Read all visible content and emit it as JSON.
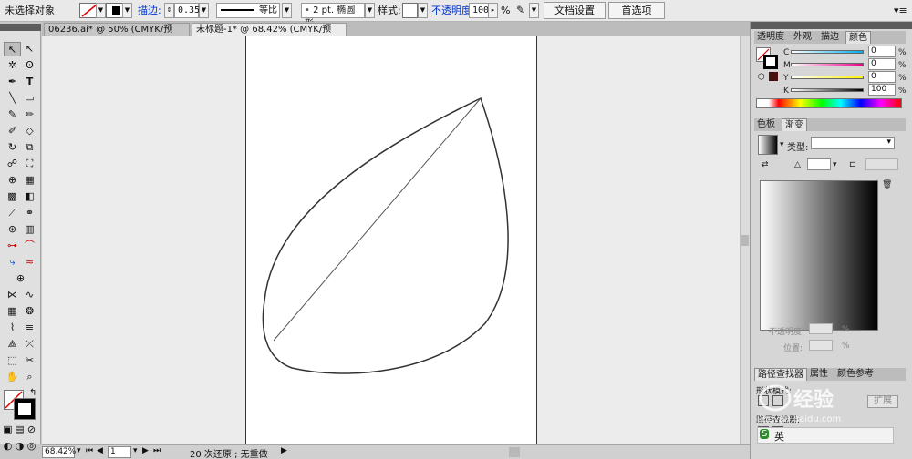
{
  "control_bar": {
    "selection_label": "未选择对象",
    "stroke_label": "描边:",
    "stroke_value": "0.353:",
    "profile_label": "等比",
    "brush_label": "2 pt. 椭圆形",
    "style_label": "样式:",
    "opacity_label": "不透明度:",
    "opacity_value": "100",
    "percent": "%",
    "doc_setup_button": "文档设置",
    "prefs_button": "首选项"
  },
  "tabs": [
    {
      "label": "06236.ai* @ 50% (CMYK/预览)",
      "active": false
    },
    {
      "label": "未标题-1* @ 68.42% (CMYK/预览)",
      "active": true
    }
  ],
  "tab_close": "✕",
  "status_bar": {
    "zoom": "68.42%",
    "page": "1",
    "undo_text": "20 次还原 ; 无重做"
  },
  "panels": {
    "top_tabs": [
      "透明度",
      "外观",
      "描边",
      "颜色"
    ],
    "color": {
      "channels": [
        {
          "label": "C",
          "value": "0"
        },
        {
          "label": "M",
          "value": "0"
        },
        {
          "label": "Y",
          "value": "0"
        },
        {
          "label": "K",
          "value": "100"
        }
      ]
    },
    "mid_tabs": [
      "色板",
      "渐变"
    ],
    "gradient": {
      "type_label": "类型:",
      "opacity_label": "不透明度:",
      "position_label": "位置:",
      "percent": "%"
    },
    "bottom_tabs": [
      "路径查找器",
      "属性",
      "颜色参考"
    ],
    "shape_modes_label": "形状模式:",
    "expand_button": "扩展",
    "pathfinder_label": "路径查找器:"
  },
  "watermark": {
    "text": "经验",
    "subtext": "jingyan.baidu.com",
    "lang": "英"
  },
  "colors": {
    "accent": "#0033cc",
    "artboard": "#ffffff",
    "canvas": "#ececec"
  }
}
